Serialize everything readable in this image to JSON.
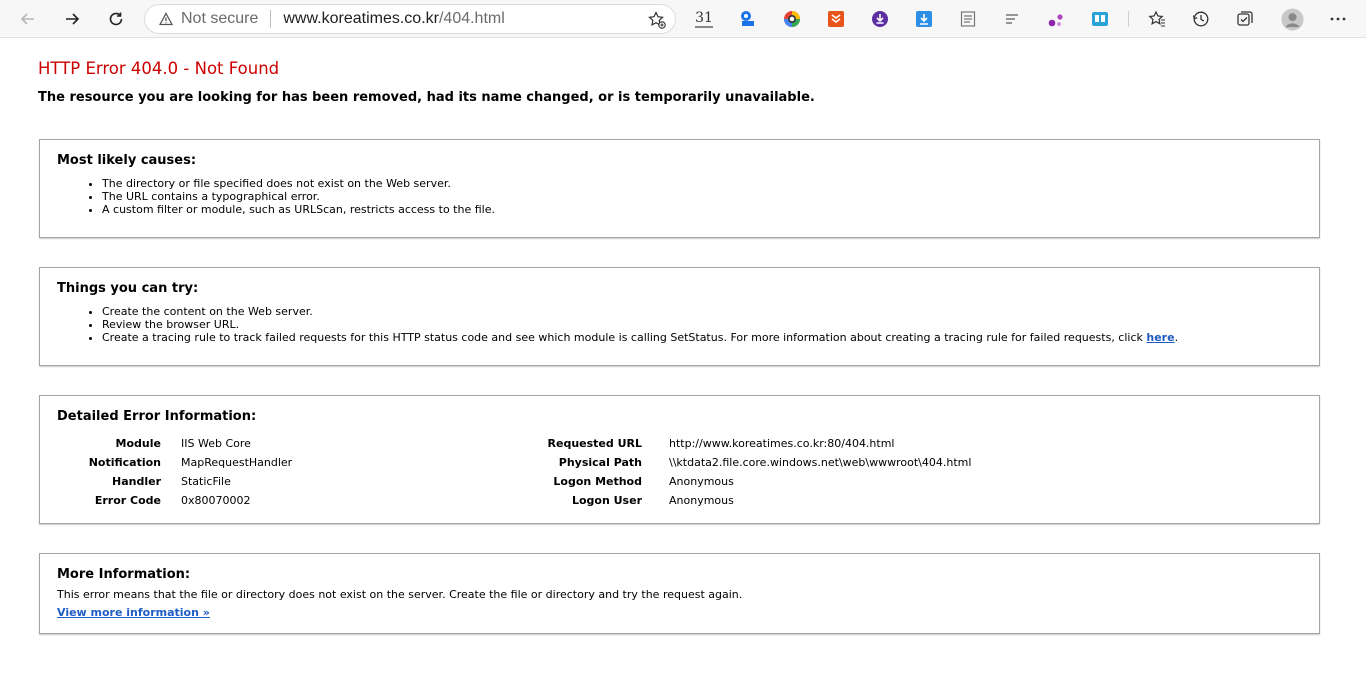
{
  "browser": {
    "security_label": "Not secure",
    "url_host": "www.koreatimes.co.kr",
    "url_path": "/404.html",
    "extension_badge": "31"
  },
  "page": {
    "title": "HTTP Error 404.0 - Not Found",
    "subtitle": "The resource you are looking for has been removed, had its name changed, or is temporarily unavailable.",
    "causes": {
      "heading": "Most likely causes:",
      "items": [
        "The directory or file specified does not exist on the Web server.",
        "The URL contains a typographical error.",
        "A custom filter or module, such as URLScan, restricts access to the file."
      ]
    },
    "try": {
      "heading": "Things you can try:",
      "items": [
        "Create the content on the Web server.",
        "Review the browser URL."
      ],
      "last_item": "Create a tracing rule to track failed requests for this HTTP status code and see which module is calling SetStatus. For more information about creating a tracing rule for failed requests, click ",
      "last_link": "here",
      "last_end": "."
    },
    "detail": {
      "heading": "Detailed Error Information:",
      "left": [
        {
          "label": "Module",
          "value": "IIS Web Core"
        },
        {
          "label": "Notification",
          "value": "MapRequestHandler"
        },
        {
          "label": "Handler",
          "value": "StaticFile"
        },
        {
          "label": "Error Code",
          "value": "0x80070002"
        }
      ],
      "right": [
        {
          "label": "Requested URL",
          "value": "http://www.koreatimes.co.kr:80/404.html"
        },
        {
          "label": "Physical Path",
          "value": "\\\\ktdata2.file.core.windows.net\\web\\wwwroot\\404.html"
        },
        {
          "label": "Logon Method",
          "value": "Anonymous"
        },
        {
          "label": "Logon User",
          "value": "Anonymous"
        }
      ]
    },
    "more": {
      "heading": "More Information:",
      "text": "This error means that the file or directory does not exist on the server. Create the file or directory and try the request again.",
      "link": "View more information »"
    }
  }
}
